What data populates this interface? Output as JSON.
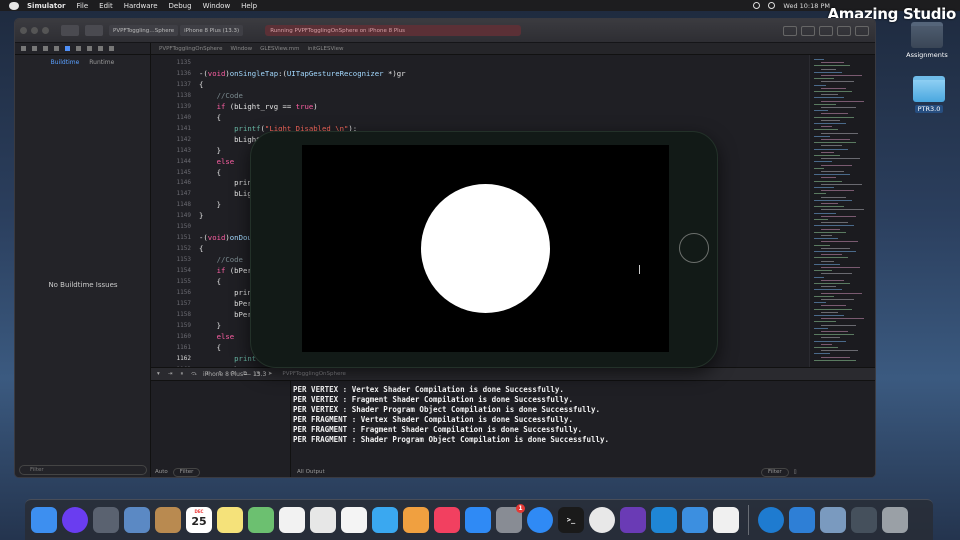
{
  "menubar": {
    "items": [
      "Simulator",
      "File",
      "Edit",
      "Hardware",
      "Debug",
      "Window",
      "Help"
    ],
    "clock": "Wed 10:18 PM"
  },
  "brand": "Amazing Studio",
  "desktop": {
    "icons": [
      {
        "label": "Assignments"
      },
      {
        "label": "PTR3.0"
      }
    ]
  },
  "xcode": {
    "scheme": "PVPFToggling…Sphere",
    "device": "iPhone 8 Plus (13.3)",
    "status": "Running PVPFTogglingOnSphere on iPhone 8 Plus",
    "jumpbar": [
      "PVPFTogglingOnSphere",
      "Window",
      "GLESView.mm",
      "initGLESView"
    ],
    "navigator": {
      "tabs": [
        "Buildtime",
        "Runtime"
      ],
      "selected_tab": "Buildtime",
      "empty_message": "No Buildtime Issues",
      "filter_placeholder": "Filter"
    },
    "code_lines": [
      {
        "num": "1135",
        "text": ""
      },
      {
        "num": "1136",
        "text": "-(void)onSingleTap:(UITapGestureRecognizer *)gr"
      },
      {
        "num": "1137",
        "text": "{"
      },
      {
        "num": "1138",
        "text": "    //Code"
      },
      {
        "num": "1139",
        "text": "    if (bLight_rvg == true)"
      },
      {
        "num": "1140",
        "text": "    {"
      },
      {
        "num": "1141",
        "text": "        printf(\"Light Disabled \\n\");"
      },
      {
        "num": "1142",
        "text": "        bLight_"
      },
      {
        "num": "1143",
        "text": "    }"
      },
      {
        "num": "1144",
        "text": "    else"
      },
      {
        "num": "1145",
        "text": "    {"
      },
      {
        "num": "1146",
        "text": "        print"
      },
      {
        "num": "1147",
        "text": "        bLigh"
      },
      {
        "num": "1148",
        "text": "    }"
      },
      {
        "num": "1149",
        "text": "}"
      },
      {
        "num": "1150",
        "text": ""
      },
      {
        "num": "1151",
        "text": "-(void)onDoubl"
      },
      {
        "num": "1152",
        "text": "{"
      },
      {
        "num": "1153",
        "text": "    //Code"
      },
      {
        "num": "1154",
        "text": "    if (bPerV"
      },
      {
        "num": "1155",
        "text": "    {"
      },
      {
        "num": "1156",
        "text": "        print"
      },
      {
        "num": "1157",
        "text": "        bPerV"
      },
      {
        "num": "1158",
        "text": "        bPerF"
      },
      {
        "num": "1159",
        "text": "    }"
      },
      {
        "num": "1160",
        "text": "    else"
      },
      {
        "num": "1161",
        "text": "    {"
      },
      {
        "num": "1162",
        "text": "        printf("
      },
      {
        "num": "1163",
        "text": "        bPerFragmentLight_rvg = false;"
      }
    ],
    "debugbar": {
      "process": "PVPFTogglingOnSphere",
      "device": "iPhone 8 Plus — 13.3"
    },
    "console_lines": [
      "PER VERTEX : Vertex Shader Compilation is done Successfully.",
      "PER VERTEX : Fragment Shader Compilation is done Successfully.",
      "PER VERTEX : Shader Program Object Compilation is done Successfully.",
      "PER FRAGMENT : Vertex Shader Compilation is done Successfully.",
      "PER FRAGMENT : Fragment Shader Compilation is done Successfully.",
      "PER FRAGMENT : Shader Program Object Compilation is done Successfully."
    ],
    "var_scope": "Auto",
    "var_filter": "Filter",
    "console_scope": "All Output",
    "console_filter": "Filter"
  },
  "simulator": {
    "title": "iPhone 8 Plus — 13.3",
    "scene": "white sphere on black background"
  },
  "dock": {
    "apps": [
      {
        "name": "Finder",
        "icon": "finder-icon",
        "color": "#3d8ff0"
      },
      {
        "name": "Siri",
        "icon": "siri-icon",
        "color": "#6a3df0"
      },
      {
        "name": "Launchpad",
        "icon": "launchpad-icon",
        "color": "#5a6270"
      },
      {
        "name": "Preview",
        "icon": "preview-icon",
        "color": "#5b89c4"
      },
      {
        "name": "Contacts",
        "icon": "contacts-icon",
        "color": "#b98a50"
      },
      {
        "name": "Calendar",
        "icon": "calendar-icon",
        "color": "#ffffff",
        "month": "DEC",
        "day": "25"
      },
      {
        "name": "Notes",
        "icon": "notes-icon",
        "color": "#f5e27a"
      },
      {
        "name": "Maps",
        "icon": "maps-icon",
        "color": "#6cc070"
      },
      {
        "name": "Reminders",
        "icon": "reminders-icon",
        "color": "#f2f2f2"
      },
      {
        "name": "Keynote",
        "icon": "keynote-icon",
        "color": "#e7e7e7"
      },
      {
        "name": "Photos",
        "icon": "photos-icon",
        "color": "#f4f4f4"
      },
      {
        "name": "Messages",
        "icon": "messages-icon",
        "color": "#3aa8f0"
      },
      {
        "name": "Pages",
        "icon": "pages-icon",
        "color": "#f0a040"
      },
      {
        "name": "Music",
        "icon": "music-icon",
        "color": "#f24060"
      },
      {
        "name": "App Store",
        "icon": "appstore-icon",
        "color": "#2f8af5"
      },
      {
        "name": "System Preferences",
        "icon": "settings-icon",
        "color": "#888c94",
        "badge": "1"
      },
      {
        "name": "Safari",
        "icon": "safari-icon",
        "color": "#2f8af5"
      },
      {
        "name": "Terminal",
        "icon": "terminal-icon",
        "color": "#1a1a1a",
        "glyph": ">_"
      },
      {
        "name": "Chrome",
        "icon": "chrome-icon",
        "color": "#e8e8e8"
      },
      {
        "name": "Visual Studio",
        "icon": "visual-studio-icon",
        "color": "#6a3bb5"
      },
      {
        "name": "VS Code",
        "icon": "vscode-icon",
        "color": "#1f86d6"
      },
      {
        "name": "Xcode",
        "icon": "xcode-icon",
        "color": "#3c8fe0"
      },
      {
        "name": "Instruments",
        "icon": "instruments-icon",
        "color": "#f0f0f0"
      }
    ],
    "right": [
      {
        "name": "Edge",
        "icon": "edge-icon",
        "color": "#1e7bd0"
      },
      {
        "name": "Xcode Downloads",
        "icon": "downloads-icon",
        "color": "#2e7fd6"
      },
      {
        "name": "Preview Window",
        "icon": "window-thumbnail-icon",
        "color": "#7a9abf"
      },
      {
        "name": "Simulator Window",
        "icon": "simulator-thumbnail-icon",
        "color": "#45505c"
      },
      {
        "name": "Trash",
        "icon": "trash-icon",
        "color": "#9aa0a6"
      }
    ]
  }
}
